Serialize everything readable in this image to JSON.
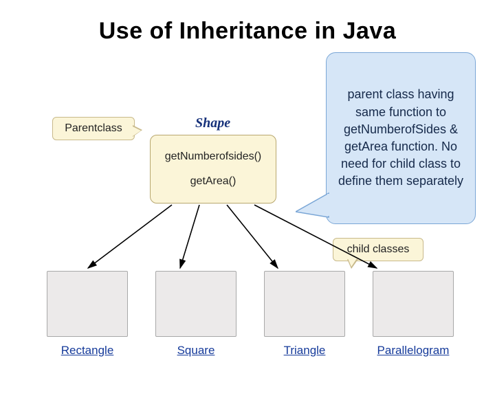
{
  "title": "Use of Inheritance in Java",
  "parent_callout_label": "Parentclass",
  "shape_label": "Shape",
  "parent_methods": {
    "m1": "getNumberofsides()",
    "m2": "getArea()"
  },
  "big_callout_text": "parent class having same function to getNumberofSides & getArea function. No need for child class to define them separately",
  "child_callout_label": "child classes",
  "children": [
    {
      "label": "Rectangle"
    },
    {
      "label": "Square"
    },
    {
      "label": "Triangle"
    },
    {
      "label": "Parallelogram"
    }
  ]
}
